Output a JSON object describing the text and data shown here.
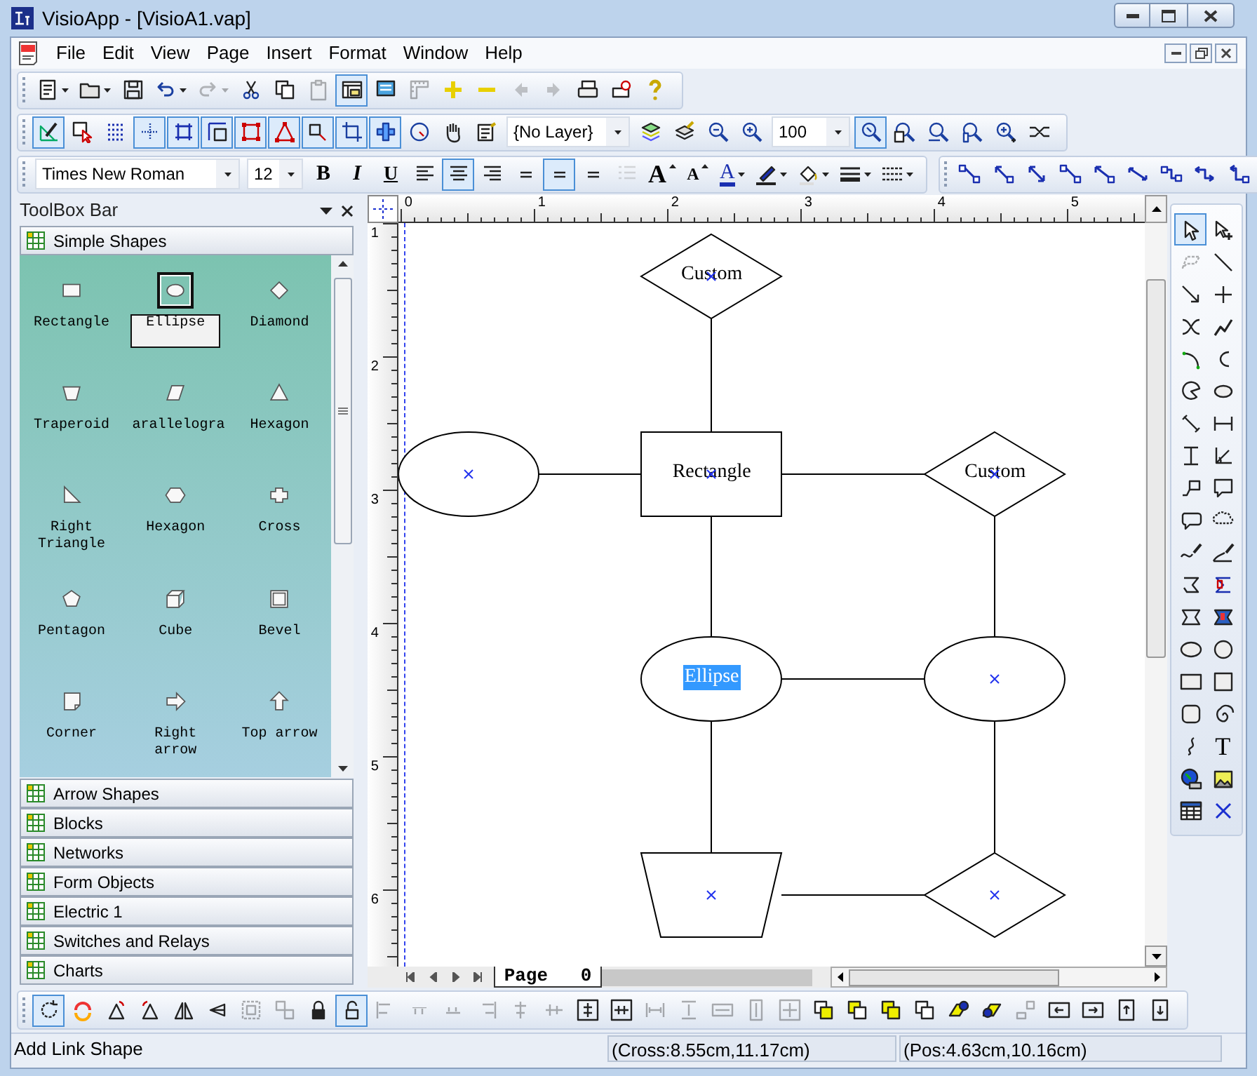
{
  "window": {
    "title": "VisioApp - [VisioA1.vap]"
  },
  "menu": [
    "File",
    "Edit",
    "View",
    "Page",
    "Insert",
    "Format",
    "Window",
    "Help"
  ],
  "standard_toolbar": [
    {
      "pressed": false,
      "disabled": false
    },
    {
      "pressed": false,
      "disabled": false
    },
    {
      "pressed": false,
      "disabled": false
    },
    {
      "pressed": false,
      "disabled": false
    },
    {
      "pressed": false,
      "disabled": true
    },
    {
      "pressed": false,
      "disabled": false
    },
    {
      "pressed": false,
      "disabled": false
    },
    {
      "pressed": false,
      "disabled": true
    },
    {
      "pressed": true,
      "disabled": false
    },
    {
      "pressed": false,
      "disabled": false
    },
    {
      "pressed": false,
      "disabled": true
    },
    {
      "pressed": false,
      "disabled": false
    },
    {
      "pressed": false,
      "disabled": false
    },
    {
      "pressed": false,
      "disabled": true
    },
    {
      "pressed": false,
      "disabled": true
    },
    {
      "pressed": false,
      "disabled": false
    },
    {
      "pressed": false,
      "disabled": false
    },
    {
      "pressed": false,
      "disabled": false
    }
  ],
  "drawing_toolbar": {
    "tools": [
      {
        "pressed": true
      },
      {
        "pressed": false
      },
      {
        "pressed": false
      },
      {
        "pressed": true
      },
      {
        "pressed": true
      },
      {
        "pressed": true
      },
      {
        "pressed": true
      },
      {
        "pressed": true
      },
      {
        "pressed": true
      },
      {
        "pressed": true
      },
      {
        "pressed": true
      },
      {
        "pressed": false
      },
      {
        "pressed": false
      },
      {
        "pressed": false
      }
    ],
    "layer": "{No Layer}",
    "layer_tools": [
      {
        "pressed": false
      },
      {
        "pressed": false
      },
      {
        "pressed": false
      },
      {
        "pressed": false
      }
    ],
    "zoom": "100",
    "zoom_tools": [
      {
        "pressed": true
      },
      {
        "pressed": false
      },
      {
        "pressed": false
      },
      {
        "pressed": false
      },
      {
        "pressed": false
      },
      {
        "pressed": false
      }
    ]
  },
  "format_toolbar": {
    "font": "Times New Roman",
    "size": "12",
    "buttons": [
      {
        "kind": "letter",
        "label": "B",
        "pressed": false,
        "disabled": false
      },
      {
        "kind": "letter",
        "label": "I",
        "pressed": false,
        "disabled": false
      },
      {
        "kind": "letter",
        "label": "U",
        "pressed": false,
        "disabled": false
      },
      {
        "kind": "icon",
        "pressed": false,
        "disabled": false
      },
      {
        "kind": "icon",
        "pressed": true,
        "disabled": false
      },
      {
        "kind": "icon",
        "pressed": false,
        "disabled": false
      },
      {
        "kind": "icon",
        "pressed": false,
        "disabled": false
      },
      {
        "kind": "icon",
        "pressed": true,
        "disabled": false
      },
      {
        "kind": "icon",
        "pressed": false,
        "disabled": false
      },
      {
        "kind": "icon",
        "pressed": false,
        "disabled": true
      },
      {
        "kind": "letter",
        "label": "A",
        "pressed": false,
        "disabled": false
      },
      {
        "kind": "letter",
        "label": "A",
        "pressed": false,
        "disabled": false
      },
      {
        "kind": "letter",
        "label": "A",
        "pressed": false,
        "disabled": false
      },
      {
        "kind": "icon",
        "pressed": false,
        "disabled": false
      },
      {
        "kind": "icon",
        "pressed": false,
        "disabled": false
      },
      {
        "kind": "icon",
        "pressed": false,
        "disabled": false
      },
      {
        "kind": "icon",
        "pressed": false,
        "disabled": false
      }
    ]
  },
  "connector_toolbar": [
    {
      "pressed": false
    },
    {
      "pressed": false
    },
    {
      "pressed": false
    },
    {
      "pressed": false
    },
    {
      "pressed": false
    },
    {
      "pressed": false
    },
    {
      "pressed": false
    },
    {
      "pressed": false
    },
    {
      "pressed": false
    }
  ],
  "toolbox": {
    "title": "ToolBox Bar",
    "open_category": "Simple Shapes",
    "shapes": [
      {
        "label": "Rectangle",
        "selected": false
      },
      {
        "label": "Ellipse",
        "selected": true
      },
      {
        "label": "Diamond",
        "selected": false
      },
      {
        "label": "Traperoid",
        "selected": false
      },
      {
        "label": "arallelogra",
        "selected": false
      },
      {
        "label": "Hexagon",
        "selected": false
      },
      {
        "label": "Right Triangle",
        "selected": false
      },
      {
        "label": "Hexagon",
        "selected": false
      },
      {
        "label": "Cross",
        "selected": false
      },
      {
        "label": "Pentagon",
        "selected": false
      },
      {
        "label": "Cube",
        "selected": false
      },
      {
        "label": "Bevel",
        "selected": false
      },
      {
        "label": "Corner",
        "selected": false
      },
      {
        "label": "Right arrow",
        "selected": false
      },
      {
        "label": "Top arrow",
        "selected": false
      }
    ],
    "categories": [
      "Arrow Shapes",
      "Blocks",
      "Networks",
      "Form Objects",
      "Electric 1",
      "Switches and Relays",
      "Charts"
    ]
  },
  "ruler": {
    "horizontal": [
      "0",
      "1",
      "2",
      "3",
      "4",
      "5"
    ],
    "vertical": [
      "1",
      "2",
      "3",
      "4",
      "5",
      "6"
    ]
  },
  "diagram": {
    "nodes": [
      {
        "kind": "diamond",
        "label": "Custom",
        "selected": false,
        "marker": true
      },
      {
        "kind": "ellipse",
        "marker": true
      },
      {
        "kind": "rectangle",
        "label": "Rectangle",
        "selected": false,
        "marker": true
      },
      {
        "kind": "diamond",
        "label": "Custom",
        "selected": false,
        "marker": true
      },
      {
        "kind": "ellipse",
        "label": "Ellipse",
        "selected": true,
        "marker": false
      },
      {
        "kind": "ellipse",
        "marker": true
      },
      {
        "kind": "trapezoid",
        "marker": true
      },
      {
        "kind": "diamond",
        "marker": true
      }
    ]
  },
  "page_tab": "Page   0",
  "tool_palette": [
    {
      "kind": "tool",
      "selected": true,
      "disabled": false
    },
    {
      "kind": "tool",
      "selected": false,
      "disabled": false
    },
    {
      "kind": "tool",
      "selected": false,
      "disabled": true
    },
    {
      "kind": "tool",
      "selected": false,
      "disabled": false
    },
    {
      "kind": "tool",
      "selected": false,
      "disabled": false
    },
    {
      "kind": "tool",
      "selected": false,
      "disabled": false
    },
    {
      "kind": "tool",
      "selected": false,
      "disabled": false
    },
    {
      "kind": "tool",
      "selected": false,
      "disabled": false
    },
    {
      "kind": "tool",
      "selected": false,
      "disabled": false
    },
    {
      "kind": "tool",
      "selected": false,
      "disabled": false
    },
    {
      "kind": "tool",
      "selected": false,
      "disabled": false
    },
    {
      "kind": "tool",
      "selected": false,
      "disabled": false
    },
    {
      "kind": "tool",
      "selected": false,
      "disabled": false
    },
    {
      "kind": "tool",
      "selected": false,
      "disabled": false
    },
    {
      "kind": "tool",
      "selected": false,
      "disabled": false
    },
    {
      "kind": "tool",
      "selected": false,
      "disabled": false
    },
    {
      "kind": "tool",
      "selected": false,
      "disabled": false
    },
    {
      "kind": "tool",
      "selected": false,
      "disabled": false
    },
    {
      "kind": "tool",
      "selected": false,
      "disabled": false
    },
    {
      "kind": "tool",
      "selected": false,
      "disabled": false
    },
    {
      "kind": "tool",
      "selected": false,
      "disabled": false
    },
    {
      "kind": "tool",
      "selected": false,
      "disabled": false
    },
    {
      "kind": "tool",
      "selected": false,
      "disabled": false
    },
    {
      "kind": "tool",
      "selected": false,
      "disabled": false
    },
    {
      "kind": "tool",
      "selected": false,
      "disabled": false
    },
    {
      "kind": "tool",
      "selected": false,
      "disabled": false
    },
    {
      "kind": "tool",
      "selected": false,
      "disabled": false
    },
    {
      "kind": "tool",
      "selected": false,
      "disabled": false
    },
    {
      "kind": "tool",
      "selected": false,
      "disabled": false
    },
    {
      "kind": "tool",
      "selected": false,
      "disabled": false
    },
    {
      "kind": "tool",
      "selected": false,
      "disabled": false
    },
    {
      "kind": "tool",
      "selected": false,
      "disabled": false
    },
    {
      "kind": "tool",
      "selected": false,
      "disabled": false
    },
    {
      "kind": "letter",
      "label": "T",
      "selected": false,
      "disabled": false
    },
    {
      "kind": "tool",
      "selected": false,
      "disabled": false
    },
    {
      "kind": "tool",
      "selected": false,
      "disabled": false
    },
    {
      "kind": "tool",
      "selected": false,
      "disabled": false
    },
    {
      "kind": "tool",
      "selected": false,
      "disabled": false
    }
  ],
  "arrange_toolbar": [
    {
      "pressed": true,
      "disabled": false
    },
    {
      "pressed": false,
      "disabled": false
    },
    {
      "pressed": false,
      "disabled": false
    },
    {
      "pressed": false,
      "disabled": false
    },
    {
      "pressed": false,
      "disabled": false
    },
    {
      "pressed": false,
      "disabled": false
    },
    {
      "pressed": false,
      "disabled": true
    },
    {
      "pressed": false,
      "disabled": true
    },
    {
      "pressed": false,
      "disabled": false
    },
    {
      "pressed": true,
      "disabled": false
    },
    {
      "pressed": false,
      "disabled": true
    },
    {
      "pressed": false,
      "disabled": true
    },
    {
      "pressed": false,
      "disabled": true
    },
    {
      "pressed": false,
      "disabled": true
    },
    {
      "pressed": false,
      "disabled": true
    },
    {
      "pressed": false,
      "disabled": true
    },
    {
      "pressed": false,
      "disabled": false
    },
    {
      "pressed": false,
      "disabled": false
    },
    {
      "pressed": false,
      "disabled": true
    },
    {
      "pressed": false,
      "disabled": true
    },
    {
      "pressed": false,
      "disabled": true
    },
    {
      "pressed": false,
      "disabled": true
    },
    {
      "pressed": false,
      "disabled": true
    },
    {
      "pressed": false,
      "disabled": false
    },
    {
      "pressed": false,
      "disabled": false
    },
    {
      "pressed": false,
      "disabled": false
    },
    {
      "pressed": false,
      "disabled": false
    },
    {
      "pressed": false,
      "disabled": false
    },
    {
      "pressed": false,
      "disabled": false
    },
    {
      "pressed": false,
      "disabled": true
    },
    {
      "pressed": false,
      "disabled": false
    },
    {
      "pressed": false,
      "disabled": false
    },
    {
      "pressed": false,
      "disabled": false
    },
    {
      "pressed": false,
      "disabled": false
    }
  ],
  "status_bar": [
    "Add Link Shape",
    "(Cross:8.55cm,11.17cm)",
    "(Pos:4.63cm,10.16cm)"
  ]
}
